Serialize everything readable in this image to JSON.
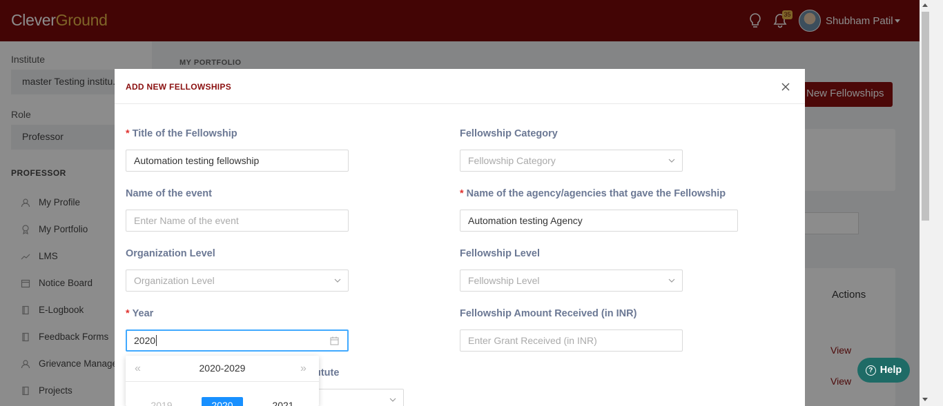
{
  "header": {
    "logo_clever": "Clever",
    "logo_ground": "Ground",
    "notification_count": "35",
    "user_name": "Shubham Patil"
  },
  "sidebar": {
    "institute_label": "Institute",
    "institute_value": "master Testing institu...",
    "role_label": "Role",
    "role_value": "Professor",
    "section_title": "PROFESSOR",
    "items": [
      {
        "label": "My Profile",
        "icon": "user-icon"
      },
      {
        "label": "My Portfolio",
        "icon": "trophy-icon"
      },
      {
        "label": "LMS",
        "icon": "chart-line-icon"
      },
      {
        "label": "Notice Board",
        "icon": "calendar-icon"
      },
      {
        "label": "E-Logbook",
        "icon": "book-icon"
      },
      {
        "label": "Feedback Forms",
        "icon": "book-icon"
      },
      {
        "label": "Grievance Manage",
        "icon": "user-icon"
      },
      {
        "label": "Projects",
        "icon": "book-icon"
      }
    ]
  },
  "content": {
    "breadcrumb": "MY PORTFOLIO",
    "add_button": "New Fellowships",
    "actions_header": "Actions",
    "view_links": [
      "View",
      "View"
    ]
  },
  "modal": {
    "title": "ADD NEW FELLOWSHIPS",
    "fields": {
      "title": {
        "label": "Title of the Fellowship",
        "required": true,
        "value": "Automation testing fellowship"
      },
      "category": {
        "label": "Fellowship Category",
        "placeholder": "Fellowship Category"
      },
      "event": {
        "label": "Name of the event",
        "placeholder": "Enter Name of the event"
      },
      "agency": {
        "label": "Name of the agency/agencies that gave the Fellowship",
        "required": true,
        "value": "Automation testing Agency"
      },
      "org_level": {
        "label": "Organization Level",
        "placeholder": "Organization Level"
      },
      "fellowship_level": {
        "label": "Fellowship Level",
        "placeholder": "Fellowship Level"
      },
      "year": {
        "label": "Year",
        "required": true,
        "value": "2020"
      },
      "amount": {
        "label": "Fellowship Amount Received (in INR)",
        "placeholder": "Enter Grant Received (in INR)"
      },
      "hidden_label": "utute"
    }
  },
  "year_picker": {
    "range": "2020-2029",
    "years": [
      "2019",
      "2020",
      "2021"
    ],
    "selected": "2020"
  },
  "help": {
    "label": "Help"
  },
  "colors": {
    "brand": "#7a0a0a",
    "accent_gold": "#e8b84a",
    "primary_blue": "#1890ff",
    "required_red": "#e0332f"
  }
}
